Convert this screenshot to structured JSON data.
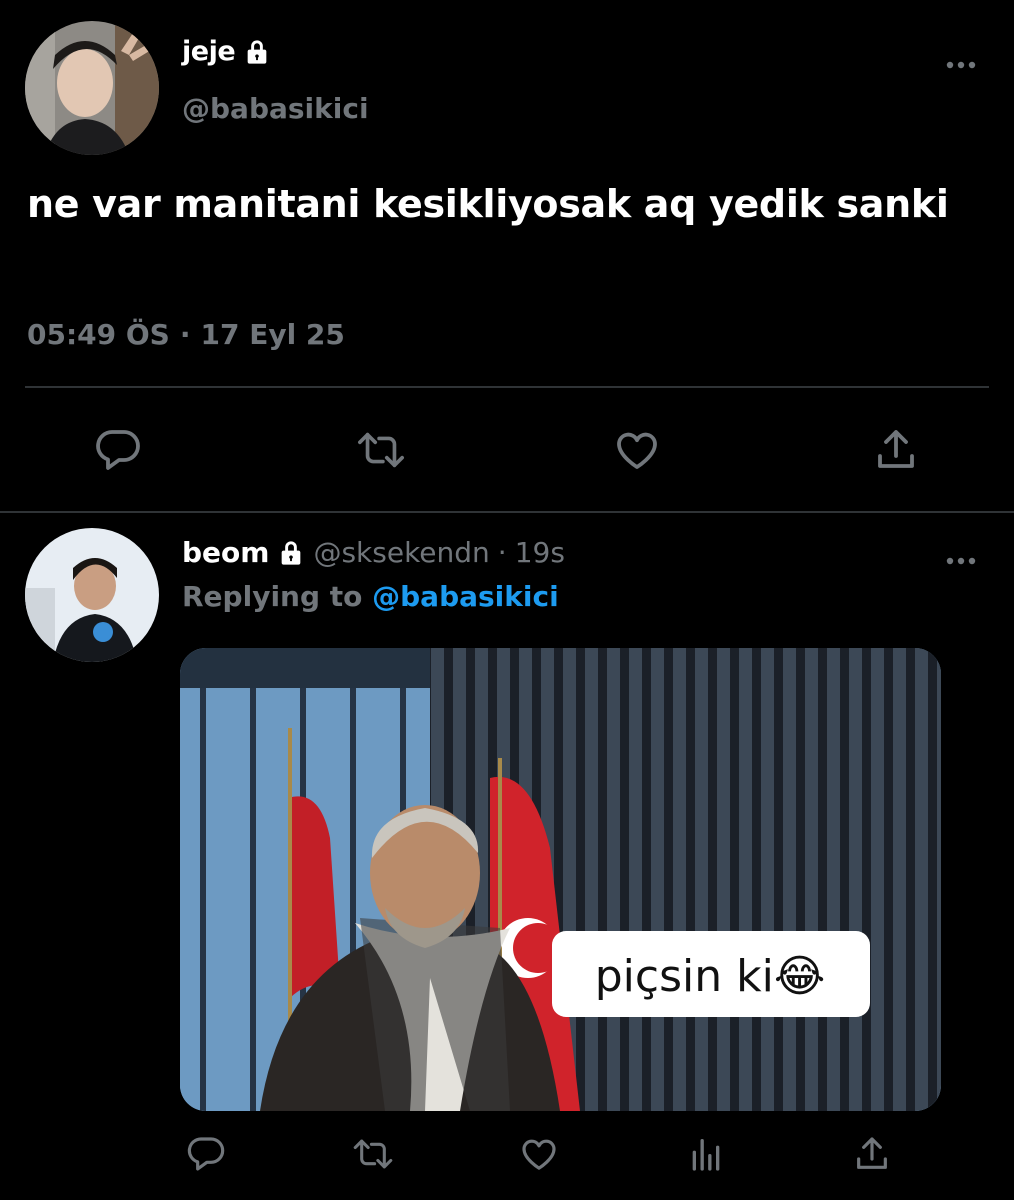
{
  "main_tweet": {
    "display_name": "jeje",
    "handle": "@babasikici",
    "text": "ne var manitani kesikliyosak aq yedik sanki",
    "time": "05:49 ÖS",
    "separator": "·",
    "date": "17 Eyl 25"
  },
  "reply": {
    "display_name": "beom",
    "handle": "@sksekendn",
    "separator": "·",
    "age": "19s",
    "replying_label": "Replying to",
    "replying_mention": "@babasikici",
    "media_caption": "piçsin ki😂"
  },
  "colors": {
    "background": "#000000",
    "secondary_text": "#71767b",
    "link": "#1d9bf0",
    "divider": "#2f3336"
  },
  "icons": [
    "lock-icon",
    "more-icon",
    "reply-icon",
    "retweet-icon",
    "like-icon",
    "share-icon",
    "analytics-icon"
  ]
}
